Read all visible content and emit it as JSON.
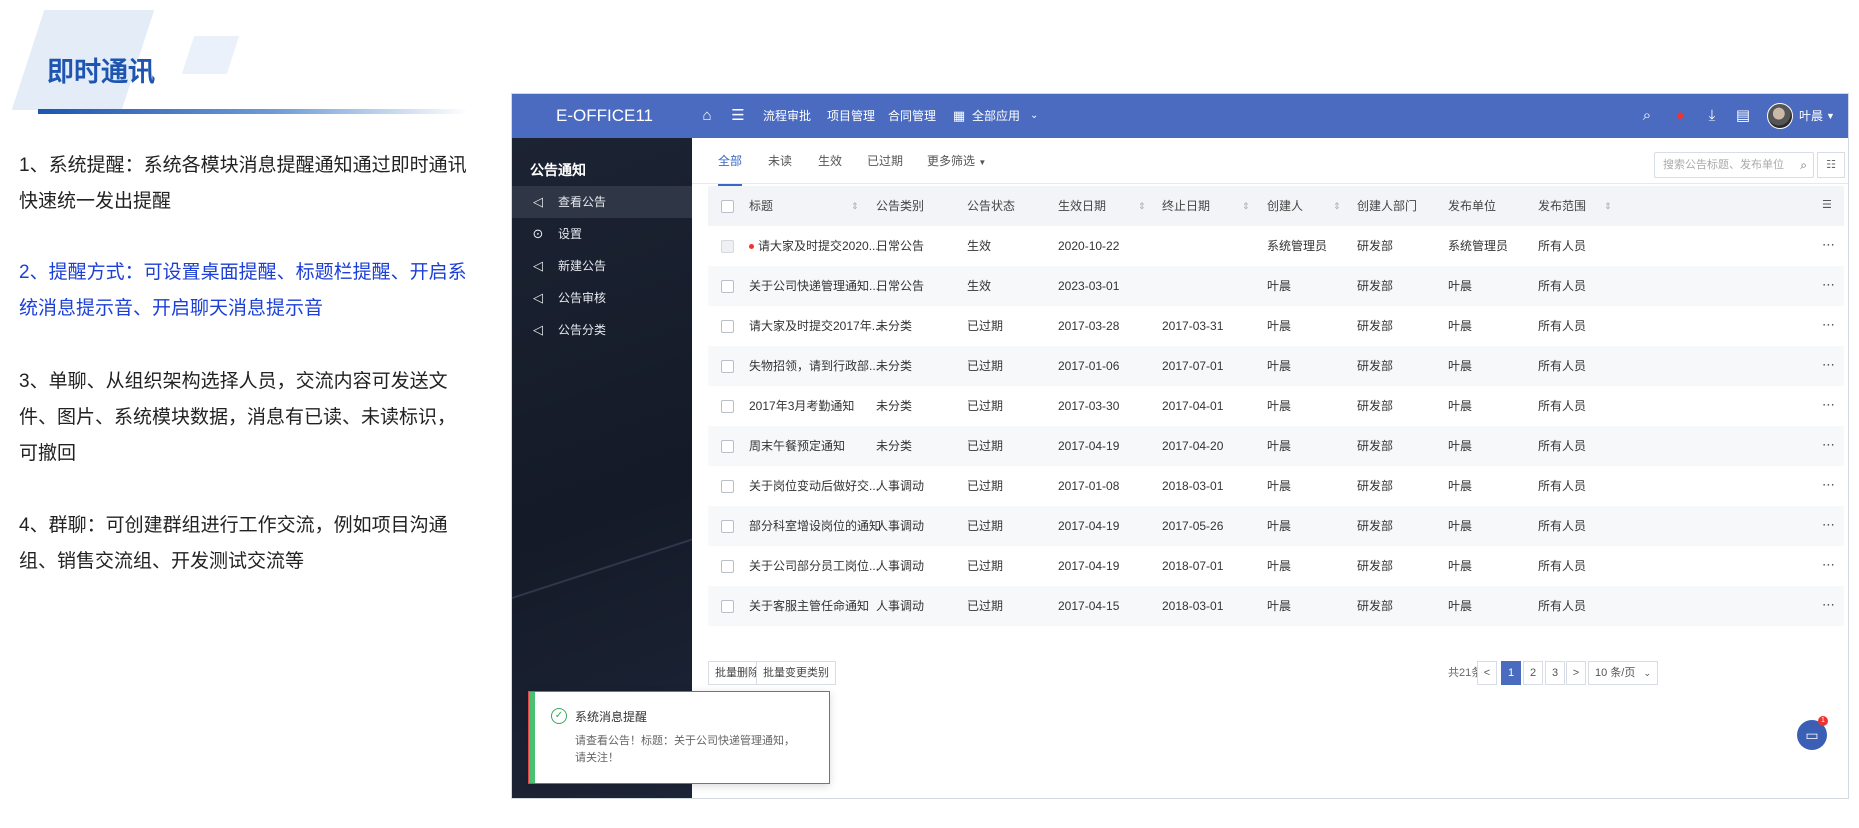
{
  "slide": {
    "title": "即时通讯",
    "paragraphs": [
      "1、系统提醒：系统各模块消息提醒通知通过即时通讯快速统一发出提醒",
      "2、提醒方式：可设置桌面提醒、标题栏提醒、开启系统消息提示音、开启聊天消息提示音",
      "3、单聊、从组织架构选择人员，交流内容可发送文件、图片、系统模块数据，消息有已读、未读标识，可撤回",
      "4、群聊：可创建群组进行工作交流，例如项目沟通组、销售交流组、开发测试交流等"
    ]
  },
  "topbar": {
    "brand": "E-OFFICE11",
    "links": [
      "流程审批",
      "项目管理",
      "合同管理"
    ],
    "all_apps": "全部应用",
    "user": "叶晨",
    "icons": [
      "home-icon",
      "menu-icon",
      "grid-icon",
      "search-icon",
      "status-dot-icon",
      "download-icon",
      "document-icon"
    ]
  },
  "sidebar": {
    "title": "公告通知",
    "items": [
      {
        "label": "查看公告",
        "icon": "megaphone-icon"
      },
      {
        "label": "设置",
        "icon": "settings-icon"
      },
      {
        "label": "新建公告",
        "icon": "megaphone-add-icon"
      },
      {
        "label": "公告审核",
        "icon": "megaphone-check-icon"
      },
      {
        "label": "公告分类",
        "icon": "megaphone-category-icon"
      }
    ]
  },
  "tabs": [
    "全部",
    "未读",
    "生效",
    "已过期",
    "更多筛选"
  ],
  "search": {
    "placeholder": "搜索公告标题、发布单位"
  },
  "table": {
    "headers": [
      "标题",
      "公告类别",
      "公告状态",
      "生效日期",
      "终止日期",
      "创建人",
      "创建人部门",
      "发布单位",
      "发布范围"
    ],
    "rows": [
      [
        "请大家及时提交2020...",
        "日常公告",
        "生效",
        "2020-10-22",
        "",
        "系统管理员",
        "研发部",
        "系统管理员",
        "所有人员"
      ],
      [
        "关于公司快递管理通知...",
        "日常公告",
        "生效",
        "2023-03-01",
        "",
        "叶晨",
        "研发部",
        "叶晨",
        "所有人员"
      ],
      [
        "请大家及时提交2017年...",
        "未分类",
        "已过期",
        "2017-03-28",
        "2017-03-31",
        "叶晨",
        "研发部",
        "叶晨",
        "所有人员"
      ],
      [
        "失物招领，请到行政部...",
        "未分类",
        "已过期",
        "2017-01-06",
        "2017-07-01",
        "叶晨",
        "研发部",
        "叶晨",
        "所有人员"
      ],
      [
        "2017年3月考勤通知",
        "未分类",
        "已过期",
        "2017-03-30",
        "2017-04-01",
        "叶晨",
        "研发部",
        "叶晨",
        "所有人员"
      ],
      [
        "周末午餐预定通知",
        "未分类",
        "已过期",
        "2017-04-19",
        "2017-04-20",
        "叶晨",
        "研发部",
        "叶晨",
        "所有人员"
      ],
      [
        "关于岗位变动后做好交...",
        "人事调动",
        "已过期",
        "2017-01-08",
        "2018-03-01",
        "叶晨",
        "研发部",
        "叶晨",
        "所有人员"
      ],
      [
        "部分科室增设岗位的通知",
        "人事调动",
        "已过期",
        "2017-04-19",
        "2017-05-26",
        "叶晨",
        "研发部",
        "叶晨",
        "所有人员"
      ],
      [
        "关于公司部分员工岗位...",
        "人事调动",
        "已过期",
        "2017-04-19",
        "2018-07-01",
        "叶晨",
        "研发部",
        "叶晨",
        "所有人员"
      ],
      [
        "关于客服主管任命通知",
        "人事调动",
        "已过期",
        "2017-04-15",
        "2018-03-01",
        "叶晨",
        "研发部",
        "叶晨",
        "所有人员"
      ]
    ]
  },
  "footer": {
    "batch_delete": "批量删除",
    "batch_change": "批量变更类别",
    "total": "共21条",
    "pages": [
      "1",
      "2",
      "3"
    ],
    "prev": "<",
    "next": ">",
    "page_size": "10 条/页"
  },
  "toast": {
    "title": "系统消息提醒",
    "body": "请查看公告！标题：关于公司快递管理通知，请关注！"
  },
  "chat_badge": "1"
}
